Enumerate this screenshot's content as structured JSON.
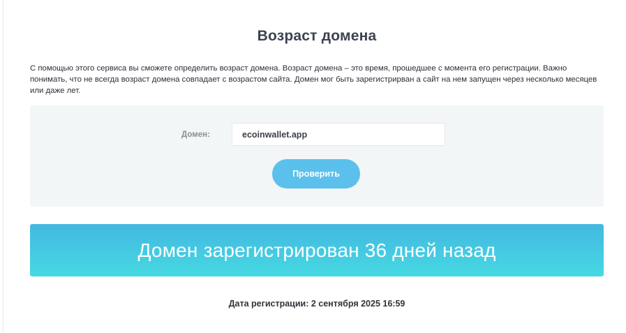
{
  "page": {
    "title": "Возраст домена",
    "intro": "С помощью этого сервиса вы сможете определить возраст домена. Возраст домена – это время, прошедшее с момента его регистрации. Важно понимать, что не всегда возраст домена совпадает с возрастом сайта. Домен мог быть зарегистрирван а сайт на нем запущен через несколько месяцев или даже лет."
  },
  "form": {
    "domain_label": "Домен:",
    "domain_value": "ecoinwallet.app",
    "check_button_label": "Проверить"
  },
  "result": {
    "banner_text": "Домен зарегистрирован 36 дней назад",
    "registration_date_text": "Дата регистрации: 2 сентября 2025 16:59"
  },
  "colors": {
    "button": "#5bc0eb",
    "banner_top": "#43b8e1",
    "banner_bottom": "#46d9e2",
    "panel_bg": "#f3f6f7"
  }
}
